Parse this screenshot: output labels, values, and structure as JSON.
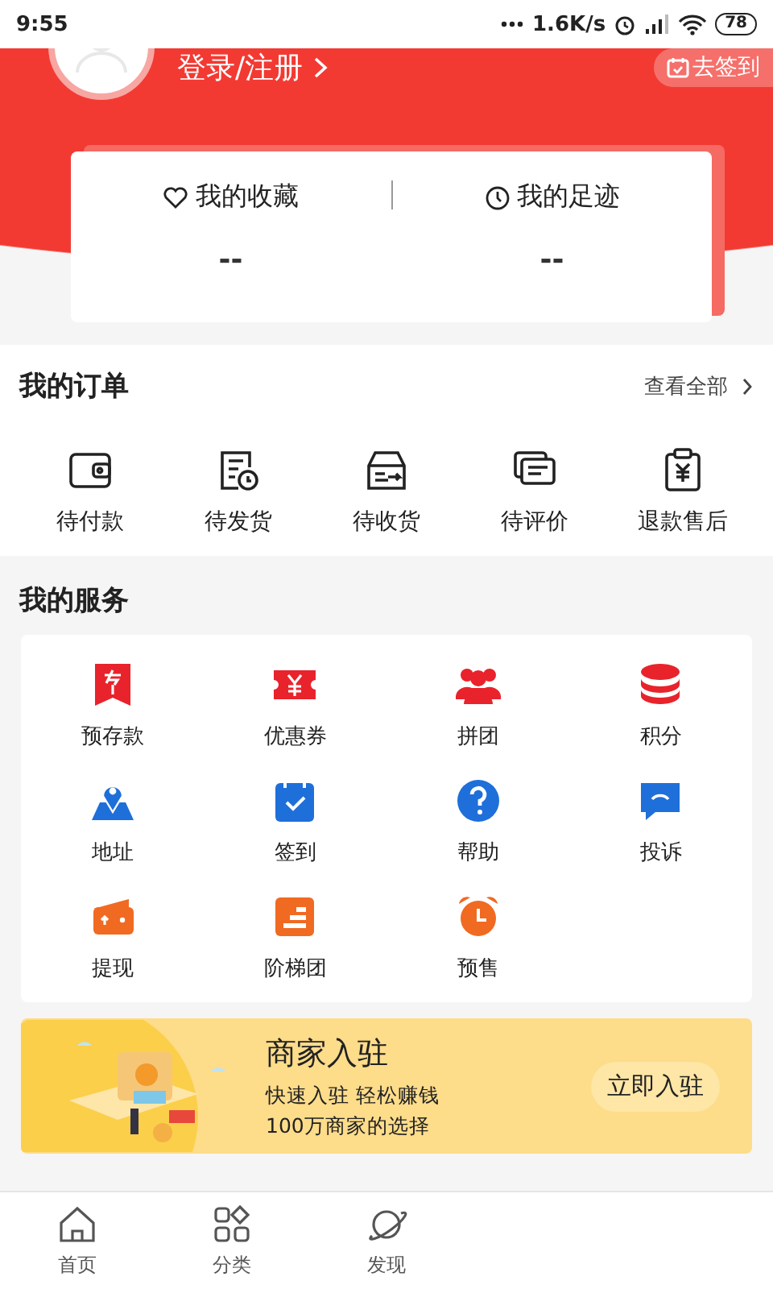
{
  "status_bar": {
    "time": "9:55",
    "speed": "1.6K/s",
    "battery": "78"
  },
  "profile": {
    "login": "登录/注册",
    "checkin": "去签到"
  },
  "stats": [
    {
      "label": "我的收藏",
      "value": "--"
    },
    {
      "label": "我的足迹",
      "value": "--"
    }
  ],
  "orders": {
    "title": "我的订单",
    "view_all": "查看全部",
    "items": [
      "待付款",
      "待发货",
      "待收货",
      "待评价",
      "退款售后"
    ]
  },
  "services": {
    "title": "我的服务",
    "items": [
      "预存款",
      "优惠券",
      "拼团",
      "积分",
      "地址",
      "签到",
      "帮助",
      "投诉",
      "提现",
      "阶梯团",
      "预售"
    ]
  },
  "banner": {
    "title": "商家入驻",
    "line1": "快速入驻 轻松赚钱",
    "line2": "100万商家的选择",
    "button": "立即入驻"
  },
  "tab_bar": [
    "首页",
    "分类",
    "发现"
  ]
}
